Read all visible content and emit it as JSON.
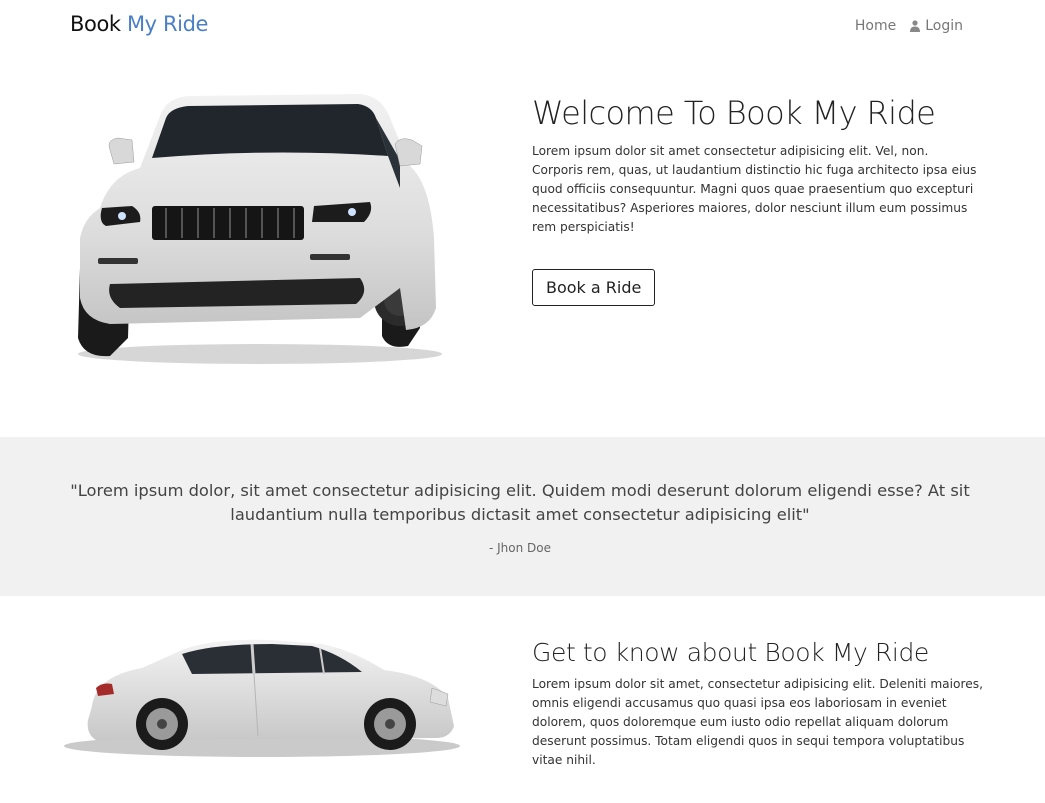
{
  "nav": {
    "brand_main": "Book",
    "brand_accent": "My Ride",
    "home_label": "Home",
    "login_label": "Login",
    "login_icon": "user-icon"
  },
  "hero": {
    "image": "white-suv-jeep-image",
    "title": "Welcome To Book My Ride",
    "description": "Lorem ipsum dolor sit amet consectetur adipisicing elit. Vel, non. Corporis rem, quas, ut laudantium distinctio hic fuga architecto ipsa eius quod officiis consequuntur. Magni quos quae praesentium quo excepturi necessitatibus? Asperiores maiores, dolor nesciunt illum eum possimus rem perspiciatis!",
    "button_label": "Book a Ride"
  },
  "testimonial": {
    "quote": "\"Lorem ipsum dolor, sit amet consectetur adipisicing elit. Quidem modi deserunt dolorum eligendi esse? At sit laudantium nulla temporibus dictasit amet consectetur adipisicing elit\"",
    "author": "- Jhon Doe"
  },
  "about": {
    "image": "white-sedan-image",
    "title": "Get to know about Book My Ride",
    "description": "Lorem ipsum dolor sit amet, consectetur adipisicing elit. Deleniti maiores, omnis eligendi accusamus quo quasi ipsa eos laboriosam in eveniet dolorem, quos doloremque eum iusto odio repellat aliquam dolorum deserunt possimus. Totam eligendi quos in sequi tempora voluptatibus vitae nihil."
  },
  "colors": {
    "brand_accent": "#4a7fc6",
    "quote_band": "#f1f1f1"
  }
}
